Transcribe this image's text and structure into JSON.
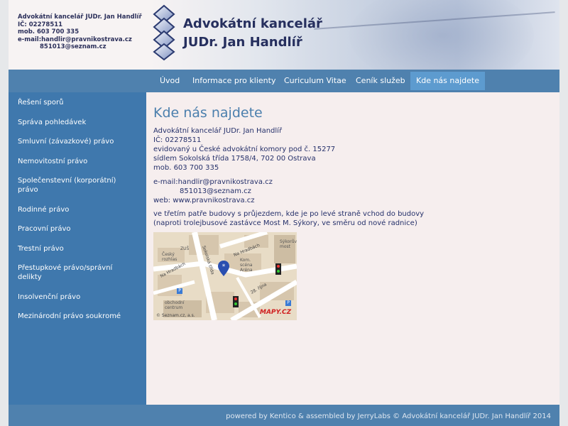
{
  "header": {
    "contact_lines": [
      "Advokátní kancelář JUDr. Jan Handlíř",
      "IČ: 02278511",
      "mob. 603 700 335",
      "e-mail:handlir@pravnikostrava.cz",
      "851013@seznam.cz"
    ],
    "title_line1": "Advokátní kancelář",
    "title_line2": "JUDr. Jan Handlíř",
    "logo_icon": "diamond-chain-logo"
  },
  "nav": {
    "items": [
      {
        "label": "Úvod"
      },
      {
        "label": "Informace pro klienty"
      },
      {
        "label": "Curiculum Vitae"
      },
      {
        "label": "Ceník služeb"
      },
      {
        "label": "Kde nás najdete",
        "active": true
      }
    ],
    "active_color": "#5d9bcf"
  },
  "sidebar": {
    "items": [
      {
        "label": "Řešení sporů"
      },
      {
        "label": "Správa pohledávek"
      },
      {
        "label": "Smluvní (závazkové) právo"
      },
      {
        "label": "Nemovitostní právo"
      },
      {
        "label": "Společenstevní (korporátní) právo"
      },
      {
        "label": "Rodinné právo"
      },
      {
        "label": "Pracovní právo"
      },
      {
        "label": "Trestní právo"
      },
      {
        "label": "Přestupkové právo/správní delikty"
      },
      {
        "label": "Insolvenční právo"
      },
      {
        "label": "Mezinárodní právo soukromé"
      }
    ]
  },
  "content": {
    "title": "Kde nás najdete",
    "address_lines": [
      "Advokátní kancelář JUDr. Jan Handlíř",
      "IČ: 02278511",
      "evidovaný u České advokátní komory pod č. 15277",
      "sídlem Sokolská třída 1758/4, 702 00 Ostrava",
      "mob. 603 700 335"
    ],
    "email_label": "e-mail:",
    "email_1": "handlir@pravnikostrava.cz",
    "email_2": "851013@seznam.cz",
    "web": "web: www.pravnikostrava.cz",
    "directions_1": "ve třetím patře budovy s průjezdem, kde je po levé straně vchod do budovy",
    "directions_2": "(naproti trolejbusové zastávce Most M. Sýkory, ve směru od nové radnice)",
    "map": {
      "labels": [
        "Český rozhlas",
        "ZUŠ",
        "Na Hradbách",
        "Sokolská třída",
        "Na Hradbách",
        "Kom. scéna Aréna",
        "Sýkorův most",
        "28. října",
        "obchodní centrum",
        "© Seznam.cz, a.s.",
        "MAPY.CZ"
      ],
      "pin_icon": "location-pin-icon"
    }
  },
  "footer": {
    "text": "powered by Kentico & assembled by JerryLabs © Advokátní kancelář JUDr. Jan Handlíř 2014"
  },
  "colors": {
    "nav_bg": "#4f81ae",
    "sidebar_bg": "#3f78ad",
    "content_bg": "#f6eeee",
    "title_color": "#4b7fad",
    "text_color": "#25306a"
  }
}
